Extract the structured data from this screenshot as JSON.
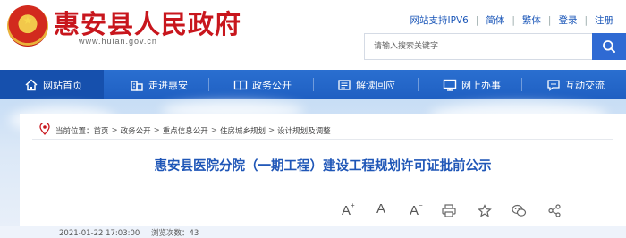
{
  "header": {
    "site_title": "惠安县人民政府",
    "site_domain": "www.huian.gov.cn",
    "links": [
      "网站支持IPV6",
      "简体",
      "繁体",
      "登录",
      "注册"
    ],
    "search_placeholder": "请输入搜索关键字"
  },
  "nav": {
    "items": [
      {
        "label": "网站首页",
        "icon": "home-icon"
      },
      {
        "label": "走进惠安",
        "icon": "buildings-icon"
      },
      {
        "label": "政务公开",
        "icon": "book-icon"
      },
      {
        "label": "解读回应",
        "icon": "document-icon"
      },
      {
        "label": "网上办事",
        "icon": "monitor-icon"
      },
      {
        "label": "互动交流",
        "icon": "chat-icon"
      }
    ],
    "active_color": "#1650ad",
    "bar_color": "#2468cb"
  },
  "breadcrumb": {
    "prefix": "当前位置：",
    "items": [
      "首页",
      "政务公开",
      "重点信息公开",
      "住房城乡规划",
      "设计规划及调整"
    ]
  },
  "article": {
    "title": "惠安县医院分院（一期工程）建设工程规划许可证批前公示",
    "date": "2021-01-22 17:03:00",
    "views_label": "浏览次数：",
    "views": "43"
  },
  "tools": {
    "font_increase": "A",
    "font_normal": "A",
    "font_decrease": "A",
    "icons": [
      "print-icon",
      "favorite-icon",
      "wechat-icon",
      "share-icon"
    ]
  },
  "colors": {
    "brand_red": "#c8161d",
    "brand_blue": "#1f56b7"
  }
}
